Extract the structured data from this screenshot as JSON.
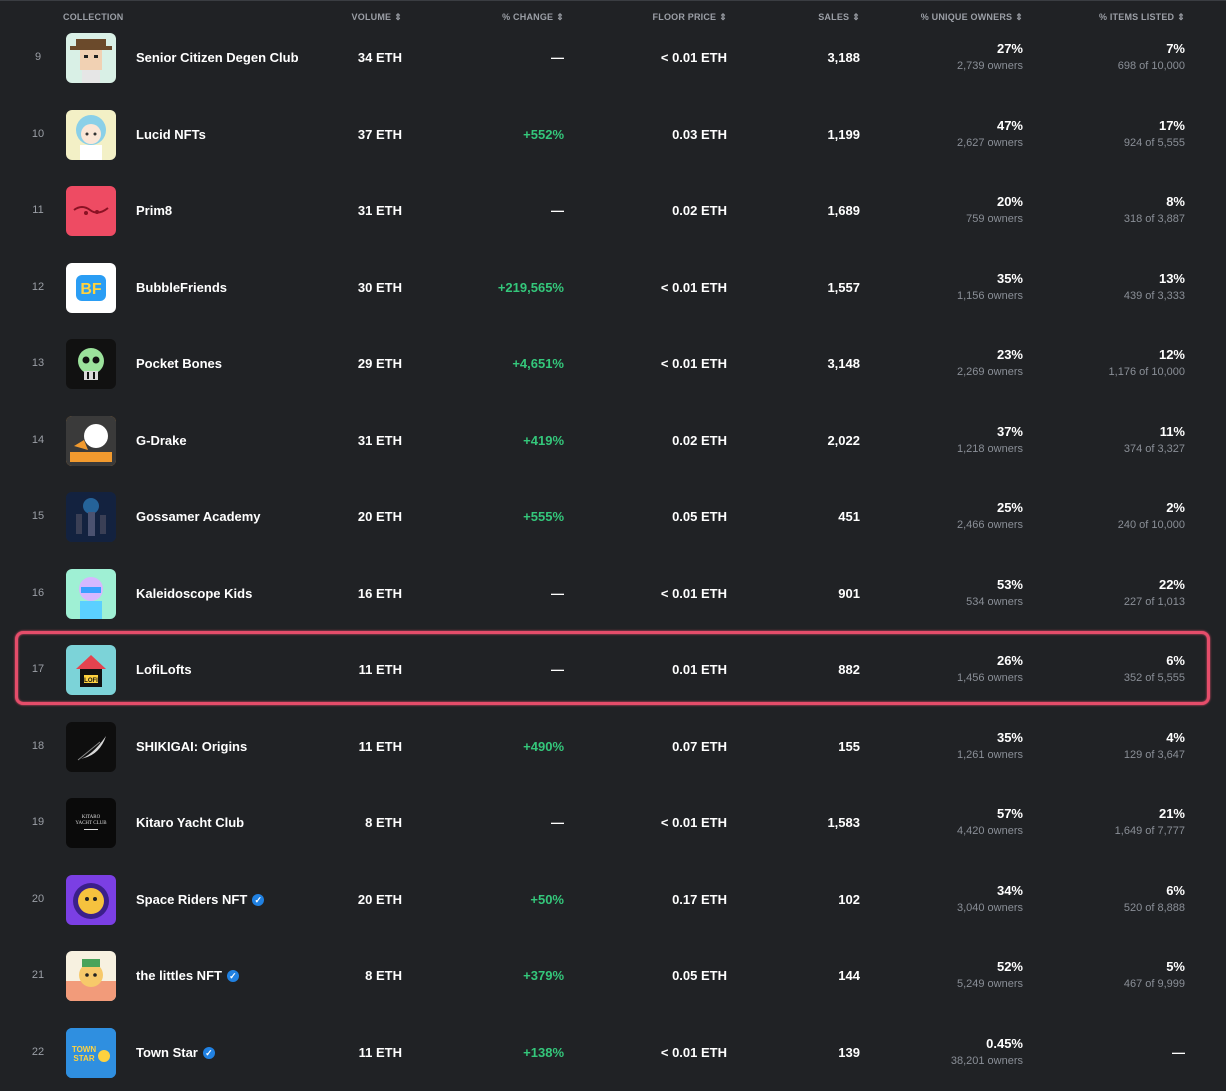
{
  "columns": {
    "collection": "COLLECTION",
    "volume": "VOLUME",
    "change": "% CHANGE",
    "floor": "FLOOR PRICE",
    "sales": "SALES",
    "owners": "% UNIQUE OWNERS",
    "listed": "% ITEMS LISTED",
    "sort_icon": "⇕"
  },
  "rows": [
    {
      "rank": "9",
      "name": "Senior Citizen Degen Club",
      "verified": false,
      "volume": "34 ETH",
      "change": "—",
      "change_up": false,
      "floor": "< 0.01 ETH",
      "sales": "3,188",
      "owners_pct": "27%",
      "owners_count": "2,739 owners",
      "listed_pct": "7%",
      "listed_of": "698 of 10,000",
      "thumb_icon": "old-cowboy-avatar",
      "thumb_bg": "#d9f0e6"
    },
    {
      "rank": "10",
      "name": "Lucid NFTs",
      "verified": false,
      "volume": "37 ETH",
      "change": "+552%",
      "change_up": true,
      "floor": "0.03 ETH",
      "sales": "1,199",
      "owners_pct": "47%",
      "owners_count": "2,627 owners",
      "listed_pct": "17%",
      "listed_of": "924 of 5,555",
      "thumb_icon": "anime-avatar",
      "thumb_bg": "#f3f0c6"
    },
    {
      "rank": "11",
      "name": "Prim8",
      "verified": false,
      "volume": "31 ETH",
      "change": "—",
      "change_up": false,
      "floor": "0.02 ETH",
      "sales": "1,689",
      "owners_pct": "20%",
      "owners_count": "759 owners",
      "listed_pct": "8%",
      "listed_of": "318 of 3,887",
      "thumb_icon": "prim8-logo",
      "thumb_bg": "#ee4b63"
    },
    {
      "rank": "12",
      "name": "BubbleFriends",
      "verified": false,
      "volume": "30 ETH",
      "change": "+219,565%",
      "change_up": true,
      "floor": "< 0.01 ETH",
      "sales": "1,557",
      "owners_pct": "35%",
      "owners_count": "1,156 owners",
      "listed_pct": "13%",
      "listed_of": "439 of 3,333",
      "thumb_icon": "bf-logo",
      "thumb_bg": "#ffffff",
      "thumb_text": "BF"
    },
    {
      "rank": "13",
      "name": "Pocket Bones",
      "verified": false,
      "volume": "29 ETH",
      "change": "+4,651%",
      "change_up": true,
      "floor": "< 0.01 ETH",
      "sales": "3,148",
      "owners_pct": "23%",
      "owners_count": "2,269 owners",
      "listed_pct": "12%",
      "listed_of": "1,176 of 10,000",
      "thumb_icon": "skull-icon",
      "thumb_bg": "#111111"
    },
    {
      "rank": "14",
      "name": "G-Drake",
      "verified": false,
      "volume": "31 ETH",
      "change": "+419%",
      "change_up": true,
      "floor": "0.02 ETH",
      "sales": "2,022",
      "owners_pct": "37%",
      "owners_count": "1,218 owners",
      "listed_pct": "11%",
      "listed_of": "374 of 3,327",
      "thumb_icon": "dragon-icon",
      "thumb_bg": "#f29a2e"
    },
    {
      "rank": "15",
      "name": "Gossamer Academy",
      "verified": false,
      "volume": "20 ETH",
      "change": "+555%",
      "change_up": true,
      "floor": "0.05 ETH",
      "sales": "451",
      "owners_pct": "25%",
      "owners_count": "2,466 owners",
      "listed_pct": "2%",
      "listed_of": "240 of 10,000",
      "thumb_icon": "group-scene-icon",
      "thumb_bg": "#1b2b4a"
    },
    {
      "rank": "16",
      "name": "Kaleidoscope Kids",
      "verified": false,
      "volume": "16 ETH",
      "change": "—",
      "change_up": false,
      "floor": "< 0.01 ETH",
      "sales": "901",
      "owners_pct": "53%",
      "owners_count": "534 owners",
      "listed_pct": "22%",
      "listed_of": "227 of 1,013",
      "thumb_icon": "kid-avatar",
      "thumb_bg": "#9ff0d4"
    },
    {
      "rank": "17",
      "name": "LofiLofts",
      "verified": false,
      "volume": "11 ETH",
      "change": "—",
      "change_up": false,
      "floor": "0.01 ETH",
      "sales": "882",
      "owners_pct": "26%",
      "owners_count": "1,456 owners",
      "listed_pct": "6%",
      "listed_of": "352 of 5,555",
      "thumb_icon": "house-icon",
      "thumb_bg": "#7cd3d8",
      "thumb_text": "LOFI"
    },
    {
      "rank": "18",
      "name": "SHIKIGAI: Origins",
      "verified": false,
      "volume": "11 ETH",
      "change": "+490%",
      "change_up": true,
      "floor": "0.07 ETH",
      "sales": "155",
      "owners_pct": "35%",
      "owners_count": "1,261 owners",
      "listed_pct": "4%",
      "listed_of": "129 of 3,647",
      "thumb_icon": "feather-icon",
      "thumb_bg": "#0e0e0e"
    },
    {
      "rank": "19",
      "name": "Kitaro Yacht Club",
      "verified": false,
      "volume": "8 ETH",
      "change": "—",
      "change_up": false,
      "floor": "< 0.01 ETH",
      "sales": "1,583",
      "owners_pct": "57%",
      "owners_count": "4,420 owners",
      "listed_pct": "21%",
      "listed_of": "1,649 of 7,777",
      "thumb_icon": "kitaro-logo",
      "thumb_bg": "#0a0a0a",
      "thumb_text": "KITARO YACHT CLUB"
    },
    {
      "rank": "20",
      "name": "Space Riders NFT",
      "verified": true,
      "volume": "20 ETH",
      "change": "+50%",
      "change_up": true,
      "floor": "0.17 ETH",
      "sales": "102",
      "owners_pct": "34%",
      "owners_count": "3,040 owners",
      "listed_pct": "6%",
      "listed_of": "520 of 8,888",
      "thumb_icon": "space-rider-avatar",
      "thumb_bg": "#7b3fe4"
    },
    {
      "rank": "21",
      "name": "the littles NFT",
      "verified": true,
      "volume": "8 ETH",
      "change": "+379%",
      "change_up": true,
      "floor": "0.05 ETH",
      "sales": "144",
      "owners_pct": "52%",
      "owners_count": "5,249 owners",
      "listed_pct": "5%",
      "listed_of": "467 of 9,999",
      "thumb_icon": "littles-avatar",
      "thumb_bg": "#f7f1e0"
    },
    {
      "rank": "22",
      "name": "Town Star",
      "verified": true,
      "volume": "11 ETH",
      "change": "+138%",
      "change_up": true,
      "floor": "< 0.01 ETH",
      "sales": "139",
      "owners_pct": "0.45%",
      "owners_count": "38,201 owners",
      "listed_pct": "—",
      "listed_of": "",
      "thumb_icon": "town-star-logo",
      "thumb_bg": "#2f8fe0",
      "thumb_text": "TOWN STAR"
    }
  ],
  "colors": {
    "background": "#202225",
    "positive": "#34c77b",
    "highlight": "#e54d6a",
    "verified": "#2081e2"
  }
}
